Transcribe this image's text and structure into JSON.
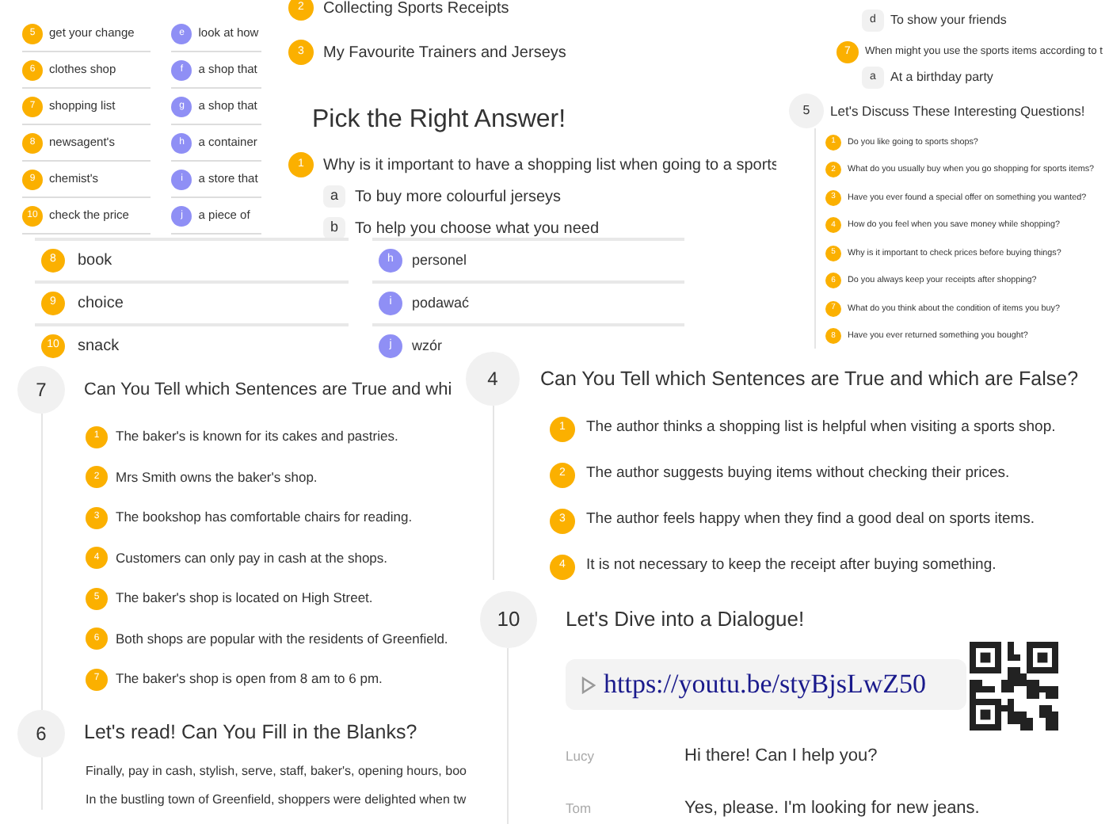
{
  "matching_card": {
    "rows": [
      {
        "number": "5",
        "term": "get your change",
        "letter": "e",
        "definition": "look at how"
      },
      {
        "number": "6",
        "term": "clothes shop",
        "letter": "f",
        "definition": "a shop that"
      },
      {
        "number": "7",
        "term": "shopping list",
        "letter": "g",
        "definition": "a shop that"
      },
      {
        "number": "8",
        "term": "newsagent's",
        "letter": "h",
        "definition": "a container"
      },
      {
        "number": "9",
        "term": "chemist's",
        "letter": "i",
        "definition": "a store that"
      },
      {
        "number": "10",
        "term": "check the price",
        "letter": "j",
        "definition": "a piece of"
      }
    ]
  },
  "quiz_card": {
    "topics": [
      {
        "number": "2",
        "text": "Collecting Sports Receipts"
      },
      {
        "number": "3",
        "text": "My Favourite Trainers and Jerseys"
      }
    ],
    "title": "Pick the Right Answer!",
    "question": {
      "number": "1",
      "text": "Why is it important to have a shopping list when going to a sports",
      "options": [
        {
          "letter": "a",
          "text": "To buy more colourful jerseys"
        },
        {
          "letter": "b",
          "text": "To help you choose what you need"
        }
      ]
    }
  },
  "word_card": {
    "rows": [
      {
        "number": "8",
        "word": "book",
        "letter": "h",
        "translation": "personel"
      },
      {
        "number": "9",
        "word": "choice",
        "letter": "i",
        "translation": "podawać"
      },
      {
        "number": "10",
        "word": "snack",
        "letter": "j",
        "translation": "wzór"
      }
    ]
  },
  "discussion_card": {
    "options": [
      {
        "letter": "d",
        "text": "To show your friends"
      }
    ],
    "question": {
      "number": "7",
      "text": "When might you use the sports items according to t",
      "options": [
        {
          "letter": "a",
          "text": "At a birthday party"
        }
      ]
    },
    "number": "5",
    "title": "Let's Discuss These Interesting Questions!",
    "questions": [
      {
        "number": "1",
        "text": "Do you like going to sports shops?"
      },
      {
        "number": "2",
        "text": "What do you usually buy when you go shopping for sports items?"
      },
      {
        "number": "3",
        "text": "Have you ever found a special offer on something you wanted?"
      },
      {
        "number": "4",
        "text": "How do you feel when you save money while shopping?"
      },
      {
        "number": "5",
        "text": "Why is it important to check prices before buying things?"
      },
      {
        "number": "6",
        "text": "Do you always keep your receipts after shopping?"
      },
      {
        "number": "7",
        "text": "What do you think about the condition of items you buy?"
      },
      {
        "number": "8",
        "text": "Have you ever returned something you bought?"
      }
    ]
  },
  "reading_card": {
    "true_false": {
      "number": "7",
      "title": "Can You Tell which Sentences are True and whi",
      "statements": [
        {
          "number": "1",
          "text": "The baker's is known for its cakes and pastries."
        },
        {
          "number": "2",
          "text": "Mrs Smith owns the baker's shop."
        },
        {
          "number": "3",
          "text": "The bookshop has comfortable chairs for reading."
        },
        {
          "number": "4",
          "text": "Customers can only pay in cash at the shops."
        },
        {
          "number": "5",
          "text": "The baker's shop is located on High Street."
        },
        {
          "number": "6",
          "text": "Both shops are popular with the residents of Greenfield."
        },
        {
          "number": "7",
          "text": "The baker's shop is open from 8 am to 6 pm."
        }
      ]
    },
    "fill_blanks": {
      "number": "6",
      "title": "Let's read! Can You Fill in the Blanks?",
      "word_bank": "Finally, pay in cash, stylish, serve, staff, baker's, opening hours, boo",
      "text": "In the bustling town of Greenfield, shoppers were delighted when tw"
    }
  },
  "true_false_card": {
    "number": "4",
    "title": "Can You Tell which Sentences are True and which are False?",
    "statements": [
      {
        "number": "1",
        "text": "The author thinks a shopping list is helpful when visiting a sports shop."
      },
      {
        "number": "2",
        "text": "The author suggests buying items without checking their prices."
      },
      {
        "number": "3",
        "text": "The author feels happy when they find a good deal on sports items."
      },
      {
        "number": "4",
        "text": "It is not necessary to keep the receipt after buying something."
      }
    ]
  },
  "dialogue_card": {
    "number": "10",
    "title": "Let's Dive into a Dialogue!",
    "link": "https://youtu.be/styBjsLwZ50",
    "lines": [
      {
        "speaker": "Lucy",
        "text": "Hi there! Can I help you?"
      },
      {
        "speaker": "Tom",
        "text": "Yes, please. I'm looking for new jeans."
      }
    ]
  }
}
